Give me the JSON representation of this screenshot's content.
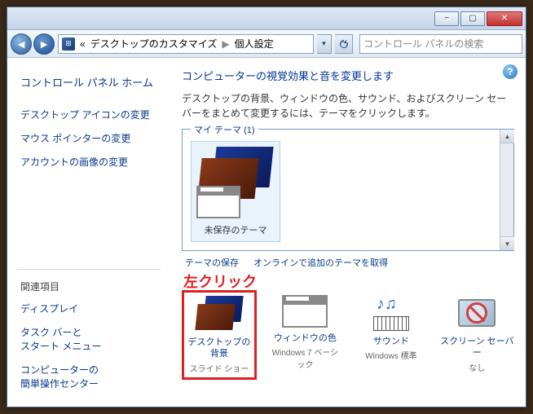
{
  "titlebar": {
    "min": "−",
    "max": "▢",
    "close": "✕"
  },
  "toolbar": {
    "back": "◄",
    "fwd": "►",
    "breadcrumb1": "デスクトップのカスタマイズ",
    "breadcrumb2": "個人設定",
    "prefix": "«",
    "sep": "▶",
    "search_placeholder": "コントロール パネルの検索"
  },
  "sidebar": {
    "home": "コントロール パネル ホーム",
    "links": [
      "デスクトップ アイコンの変更",
      "マウス ポインターの変更",
      "アカウントの画像の変更"
    ],
    "related_head": "関連項目",
    "related": [
      "ディスプレイ",
      "タスク バーと\nスタート メニュー",
      "コンピューターの\n簡単操作センター"
    ]
  },
  "content": {
    "help": "?",
    "heading": "コンピューターの視覚効果と音を変更します",
    "desc": "デスクトップの背景、ウィンドウの色、サウンド、およびスクリーン セーバーをまとめて変更するには、テーマをクリックします。",
    "themes_label": "マイ テーマ (1)",
    "theme_item": "未保存のテーマ",
    "link_save": "テーマの保存",
    "link_online": "オンラインで追加のテーマを取得",
    "annotation": "左クリック",
    "bottom": [
      {
        "label": "デスクトップの背景",
        "sub": "スライド ショー"
      },
      {
        "label": "ウィンドウの色",
        "sub": "Windows 7 ベーシック"
      },
      {
        "label": "サウンド",
        "sub": "Windows 標準"
      },
      {
        "label": "スクリーン セーバー",
        "sub": "なし"
      }
    ]
  }
}
